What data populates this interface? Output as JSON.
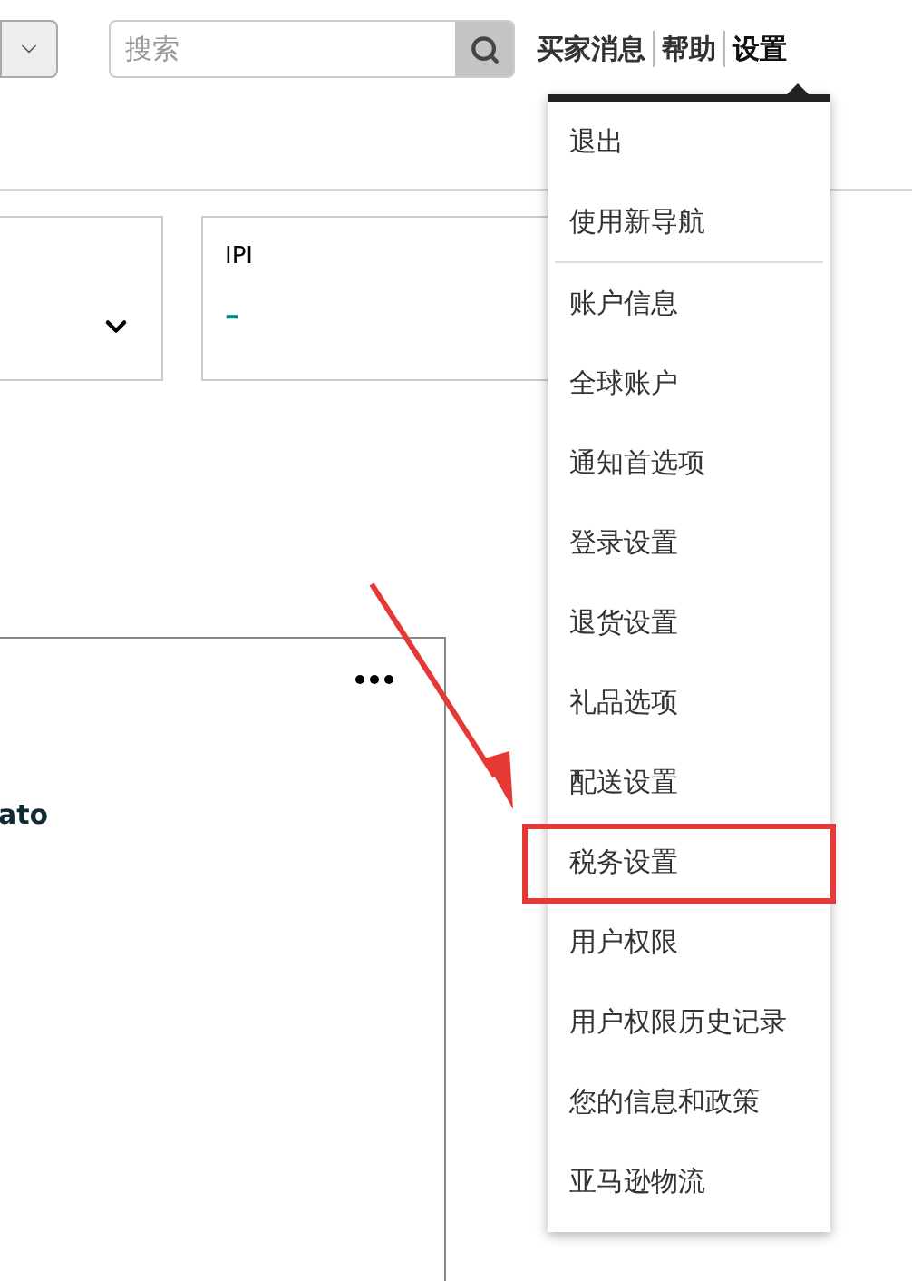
{
  "header": {
    "search": {
      "placeholder": "搜索"
    },
    "links": [
      {
        "label": "买家消息",
        "selected": false
      },
      {
        "label": "帮助",
        "selected": false
      },
      {
        "label": "设置",
        "selected": true
      }
    ]
  },
  "cards": [
    {
      "kind": "dropdown"
    },
    {
      "kind": "metric",
      "title": "IPI",
      "value": "–"
    }
  ],
  "panel": {
    "text": "ato"
  },
  "menu": {
    "groups": [
      [
        {
          "label": "退出",
          "highlighted": false
        },
        {
          "label": "使用新导航",
          "highlighted": false
        }
      ],
      [
        {
          "label": "账户信息",
          "highlighted": false
        },
        {
          "label": "全球账户",
          "highlighted": false
        },
        {
          "label": "通知首选项",
          "highlighted": false
        },
        {
          "label": "登录设置",
          "highlighted": false
        },
        {
          "label": "退货设置",
          "highlighted": false
        },
        {
          "label": "礼品选项",
          "highlighted": false
        },
        {
          "label": "配送设置",
          "highlighted": false
        },
        {
          "label": "税务设置",
          "highlighted": true
        },
        {
          "label": "用户权限",
          "highlighted": false
        },
        {
          "label": "用户权限历史记录",
          "highlighted": false
        },
        {
          "label": "您的信息和政策",
          "highlighted": false
        },
        {
          "label": "亚马逊物流",
          "highlighted": false
        }
      ]
    ]
  }
}
